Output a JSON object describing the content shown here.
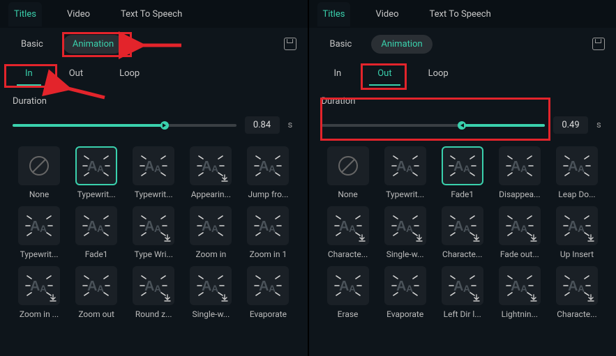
{
  "colors": {
    "accent": "#3ad1ad",
    "annotation": "#e3242b"
  },
  "left": {
    "top_tabs": [
      "Titles",
      "Video",
      "Text To Speech"
    ],
    "top_active": 0,
    "sub_tabs": [
      "Basic",
      "Animation"
    ],
    "sub_active": 1,
    "anim_tabs": [
      "In",
      "Out",
      "Loop"
    ],
    "anim_active": 0,
    "duration_label": "Duration",
    "duration_value": "0.84",
    "duration_unit": "s",
    "slider_pct": 68,
    "slider_dir": "right",
    "presets": [
      {
        "label": "None",
        "icon": "none",
        "dl": false,
        "sel": false
      },
      {
        "label": "Typewrit...",
        "icon": "aa",
        "dl": false,
        "sel": true
      },
      {
        "label": "Typewrit...",
        "icon": "aa",
        "dl": false,
        "sel": false
      },
      {
        "label": "Appearin...",
        "icon": "aa",
        "dl": true,
        "sel": false
      },
      {
        "label": "Jump fro...",
        "icon": "aa",
        "dl": false,
        "sel": false
      },
      {
        "label": "Typewrit...",
        "icon": "aa",
        "dl": false,
        "sel": false
      },
      {
        "label": "Fade1",
        "icon": "aa",
        "dl": false,
        "sel": false
      },
      {
        "label": "Type Wri...",
        "icon": "aa",
        "dl": true,
        "sel": false
      },
      {
        "label": "Zoom in",
        "icon": "aa",
        "dl": false,
        "sel": false
      },
      {
        "label": "Zoom in 1",
        "icon": "aa",
        "dl": false,
        "sel": false
      },
      {
        "label": "Zoom in ...",
        "icon": "aa",
        "dl": true,
        "sel": false
      },
      {
        "label": "Zoom out",
        "icon": "aa",
        "dl": false,
        "sel": false
      },
      {
        "label": "Round z...",
        "icon": "aa",
        "dl": true,
        "sel": false
      },
      {
        "label": "Single-w...",
        "icon": "aa",
        "dl": true,
        "sel": false
      },
      {
        "label": "Evaporate",
        "icon": "aa",
        "dl": false,
        "sel": false
      }
    ]
  },
  "right": {
    "top_tabs": [
      "Titles",
      "Video",
      "Text To Speech"
    ],
    "top_active": 0,
    "sub_tabs": [
      "Basic",
      "Animation"
    ],
    "sub_active": 1,
    "anim_tabs": [
      "In",
      "Out",
      "Loop"
    ],
    "anim_active": 1,
    "duration_label": "Duration",
    "duration_value": "0.49",
    "duration_unit": "s",
    "slider_pct": 63,
    "slider_dir": "left",
    "slider_fill_from_right": true,
    "presets": [
      {
        "label": "None",
        "icon": "none",
        "dl": false,
        "sel": false
      },
      {
        "label": "Typewrit...",
        "icon": "aa",
        "dl": false,
        "sel": false
      },
      {
        "label": "Fade1",
        "icon": "aa",
        "dl": false,
        "sel": true
      },
      {
        "label": "Disappea...",
        "icon": "aa",
        "dl": false,
        "sel": false
      },
      {
        "label": "Leap Do...",
        "icon": "aa",
        "dl": false,
        "sel": false
      },
      {
        "label": "Characte...",
        "icon": "aa",
        "dl": true,
        "sel": false
      },
      {
        "label": "Single-w...",
        "icon": "aa",
        "dl": true,
        "sel": false
      },
      {
        "label": "Characte...",
        "icon": "aa",
        "dl": true,
        "sel": false
      },
      {
        "label": "Fade out...",
        "icon": "aa",
        "dl": true,
        "sel": false
      },
      {
        "label": "Up Insert",
        "icon": "aa",
        "dl": true,
        "sel": false
      },
      {
        "label": "Erase",
        "icon": "aa",
        "dl": false,
        "sel": false
      },
      {
        "label": "Evaporate",
        "icon": "aa",
        "dl": false,
        "sel": false
      },
      {
        "label": "Left Dir l...",
        "icon": "aa",
        "dl": true,
        "sel": false
      },
      {
        "label": "Lightnin...",
        "icon": "aa",
        "dl": true,
        "sel": false
      },
      {
        "label": "Characte...",
        "icon": "aa",
        "dl": true,
        "sel": false
      }
    ]
  }
}
